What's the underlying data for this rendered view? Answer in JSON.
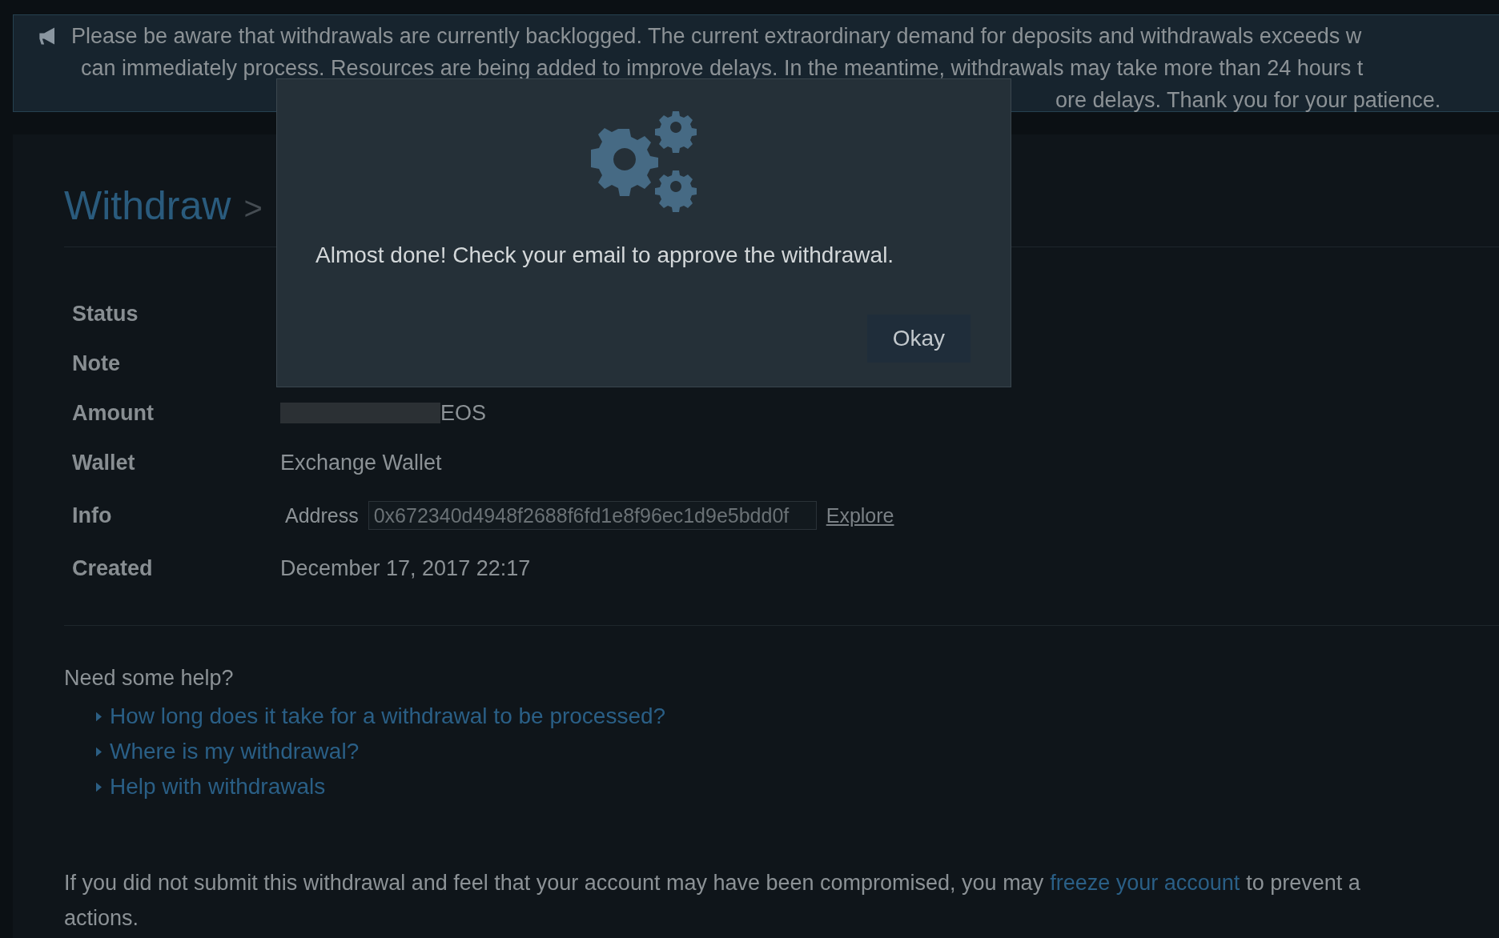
{
  "banner": {
    "lines": [
      "Please be aware that withdrawals are currently backlogged. The current extraordinary demand for deposits and withdrawals exceeds w",
      "can immediately process. Resources are being added to improve delays. In the meantime, withdrawals may take more than 24 hours t",
      "ore delays. Thank you for your patience."
    ]
  },
  "page": {
    "title": "Withdraw",
    "separator": ">"
  },
  "details": [
    {
      "label": "Status"
    },
    {
      "label": "Note"
    },
    {
      "label": "Amount",
      "kind": "amount",
      "value": "EOS"
    },
    {
      "label": "Wallet",
      "value": "Exchange Wallet"
    },
    {
      "label": "Info",
      "kind": "address",
      "field_label": "Address",
      "value": "0x672340d4948f2688f6fd1e8f96ec1d9e5bdd0f",
      "link": "Explore"
    },
    {
      "label": "Created",
      "value": "December 17, 2017 22:17"
    }
  ],
  "help": {
    "title": "Need some help?",
    "links": [
      "How long does it take for a withdrawal to be processed?",
      "Where is my withdrawal?",
      "Help with withdrawals"
    ]
  },
  "notice": {
    "before": "If you did not submit this withdrawal and feel that your account may have been compromised, you may",
    "link": "freeze your account",
    "after": "to prevent a",
    "line2": "actions."
  },
  "modal": {
    "message": "Almost done! Check your email to approve the withdrawal.",
    "button": "Okay"
  }
}
